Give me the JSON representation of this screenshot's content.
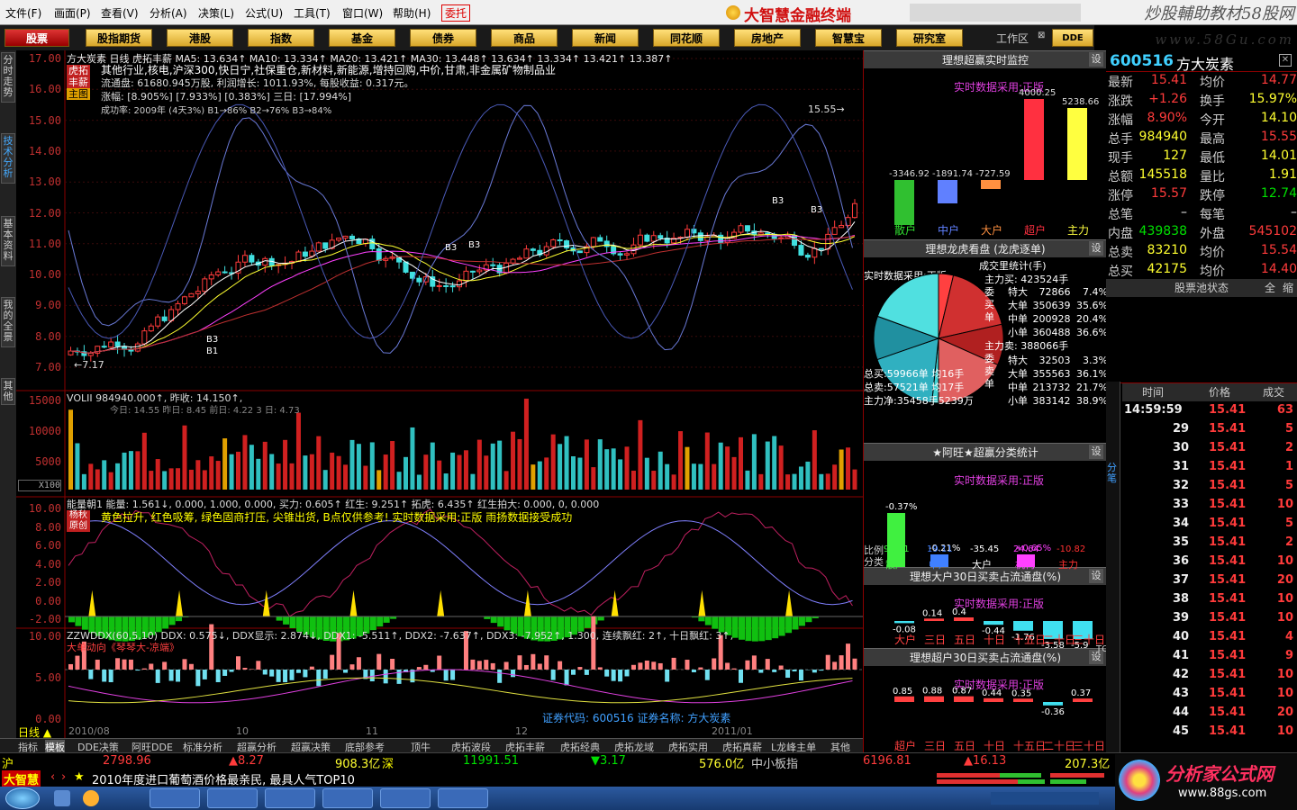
{
  "menu": {
    "items": [
      "文件(F)",
      "画面(P)",
      "查看(V)",
      "分析(A)",
      "决策(L)",
      "公式(U)",
      "工具(T)",
      "窗口(W)",
      "帮助(H)"
    ],
    "entrust": "委托",
    "brand": "大智慧金融终端",
    "watermark_top": "炒股輔助教材58股网",
    "watermark_url": "www.58Gu.com"
  },
  "nav": {
    "items": [
      "股票",
      "股指期货",
      "港股",
      "指数",
      "基金",
      "债券",
      "商品",
      "新闻",
      "同花顺",
      "房地产",
      "智慧宝",
      "研究室"
    ],
    "workspace": "工作区",
    "dde": "DDE"
  },
  "sidebar": {
    "tabs": [
      "分时走势",
      "技术分析",
      "基本资料",
      "我的全景",
      "其他"
    ]
  },
  "main": {
    "header": "方大炭素 日线 虎拓丰薪 MA5: 13.634↑ MA10: 13.334↑ MA20: 13.421↑ MA30: 13.448↑ 13.634↑ 13.334↑ 13.421↑ 13.387↑",
    "tags": [
      "虎拓",
      "丰薪",
      "主图"
    ],
    "info1": "其他行业,核电,沪深300,快日宁,社保重仓,新材料,新能源,增持回购,中价,甘肃,非金属矿物制品业",
    "info2": "流通盘: 61680.945万股, 利润增长: 1011.93%, 每股收益: 0.317元。",
    "info3": "涨幅: [8.905%] [7.933%] [0.383%] 三日: [17.994%]",
    "info4": "成功率: 2009年 (4天3%) B1→86% B2→76% B3→84%",
    "price_labels": [
      "17.00",
      "16.00",
      "15.00",
      "14.00",
      "13.00",
      "12.00",
      "11.00",
      "10.00",
      "9.00",
      "8.00",
      "7.00"
    ],
    "low_label": "7.17",
    "high_label": "15.55",
    "b_labels": [
      "B1",
      "B3",
      "B3",
      "B3",
      "B3",
      "B3"
    ],
    "vol_header": "VOLII 984940.000↑, 昨收: 14.150↑,",
    "vol_sub": "今日: 14.55  昨日: 8.45  前日: 4.22  3 日: 4.73",
    "vol_labels": [
      "15000",
      "10000",
      "5000",
      "X100"
    ],
    "energy_header": "能量朝1  能量: 1.561↓, 0.000, 1.000, 0.000, 买力: 0.605↑ 红生: 9.251↑ 拓虎: 6.435↑ 红生拍大: 0.000, 0, 0.000",
    "energy_sub": "黄色拉升, 红色吸筹, 绿色固商打压, 尖锥出货, B点仅供参考!  实时数据采用:正版  雨扬数据接受成功",
    "energy_tags": [
      "杨秋",
      "原创"
    ],
    "energy_labels": [
      "10.00",
      "8.00",
      "6.00",
      "4.00",
      "2.00",
      "0.00",
      "-2.00"
    ],
    "ddx_header": "ZZWDDX(60,5,10) DDX: 0.575↓, DDX显示: 2.874↓, DDX1: -5.511↑, DDX2: -7.637↑, DDX3: -7.952↑, 1.300, 连续飘红: 2↑, 十日飘红: 3↑,",
    "ddx_sub": "大单动向《琴琴大-凉端》",
    "ddx_labels": [
      "10.00",
      "5.00",
      "0.00"
    ],
    "stock_code": "证券代码: 600516  证券名称: 方大炭素",
    "date_labels": [
      "2010/08",
      "10",
      "11",
      "12",
      "2011/01"
    ],
    "period": "日线"
  },
  "right": {
    "h1": "理想超赢实时监控",
    "set": "设",
    "realtime": "实时数据采用:正版",
    "bars1": [
      {
        "label": "散户",
        "val": "-3346.92"
      },
      {
        "label": "中户",
        "val": "-1891.74"
      },
      {
        "label": "大户",
        "val": "-727.59"
      },
      {
        "label": "超户",
        "val": "4000.25"
      },
      {
        "label": "主力",
        "val": "5238.66"
      }
    ],
    "h2": "理想龙虎看盘 (龙虎逐单)",
    "vol_stat_title": "成交里统计(手)",
    "buy_main": "主力买: 423524手",
    "buy_rows": [
      [
        "特大",
        "72866",
        "7.4%"
      ],
      [
        "大单",
        "350639",
        "35.6%"
      ],
      [
        "中单",
        "200928",
        "20.4%"
      ],
      [
        "小单",
        "360488",
        "36.6%"
      ]
    ],
    "sell_main": "主力卖: 388066手",
    "sell_rows": [
      [
        "特大",
        "32503",
        "3.3%"
      ],
      [
        "大单",
        "355563",
        "36.1%"
      ],
      [
        "中单",
        "213732",
        "21.7%"
      ],
      [
        "小单",
        "383142",
        "38.9%"
      ]
    ],
    "side_buy": "委买单",
    "side_sell": "委卖单",
    "total_buy": "总买:59966单 均16手",
    "total_sell": "总卖:57521单 均17手",
    "main_net": "主力净:35458手5239万",
    "h3": "★阿旺★超赢分类统计",
    "bars3": [
      {
        "label": "散户",
        "pct": "-0.37%",
        "val": "91.71"
      },
      {
        "label": "中户",
        "pct": "-0.21%",
        "val": "19.11"
      },
      {
        "label": "大户",
        "pct": "",
        "val": "-35.45"
      },
      {
        "label": "机构",
        "pct": "+0.65%",
        "val": "24.64"
      },
      {
        "label": "主力",
        "pct": "",
        "val": "-10.82"
      }
    ],
    "ratio_label": "比例分类",
    "h4": "理想大户30日买卖占流通盘(%)",
    "bars4": {
      "labels": [
        "大户",
        "三日",
        "五日",
        "十日",
        "十五日",
        "二十日",
        "三十日"
      ],
      "vals": [
        "-0.08",
        "0.14",
        "0.4",
        "-0.44",
        "-1.76",
        "-3.58",
        "-5.9"
      ]
    },
    "h5": "理想超户30日买卖占流通盘(%)",
    "bars5": {
      "labels": [
        "超户",
        "三日",
        "五日",
        "十日",
        "十五日",
        "二十日",
        "三十日"
      ],
      "vals": [
        "0.85",
        "0.88",
        "0.87",
        "0.44",
        "0.35",
        "-0.36",
        "0.37"
      ]
    },
    "top_label": "TOP"
  },
  "quote": {
    "code": "600516",
    "name": "方大炭素",
    "rows": [
      {
        "l": "最新",
        "v1": "15.41",
        "c1": "red",
        "l2": "均价",
        "v2": "14.77",
        "c2": "red"
      },
      {
        "l": "涨跌",
        "v1": "+1.26",
        "c1": "red",
        "l2": "换手",
        "v2": "15.97%",
        "c2": "yellow"
      },
      {
        "l": "涨幅",
        "v1": "8.90%",
        "c1": "red",
        "l2": "今开",
        "v2": "14.10",
        "c2": "yellow"
      },
      {
        "l": "总手",
        "v1": "984940",
        "c1": "yellow",
        "l2": "最高",
        "v2": "15.55",
        "c2": "red"
      },
      {
        "l": "现手",
        "v1": "127",
        "c1": "yellow",
        "l2": "最低",
        "v2": "14.01",
        "c2": "yellow"
      },
      {
        "l": "总额",
        "v1": "145518",
        "c1": "yellow",
        "l2": "量比",
        "v2": "1.91",
        "c2": "yellow"
      },
      {
        "l": "涨停",
        "v1": "15.57",
        "c1": "red",
        "l2": "跌停",
        "v2": "12.74",
        "c2": "green"
      },
      {
        "l": "总笔",
        "v1": "–",
        "c1": "white",
        "l2": "每笔",
        "v2": "–",
        "c2": "white"
      },
      {
        "l": "内盘",
        "v1": "439838",
        "c1": "green",
        "l2": "外盘",
        "v2": "545102",
        "c2": "red"
      },
      {
        "l": "总卖",
        "v1": "83210",
        "c1": "yellow",
        "l2": "均价",
        "v2": "15.54",
        "c2": "red"
      },
      {
        "l": "总买",
        "v1": "42175",
        "c1": "yellow",
        "l2": "均价",
        "v2": "14.40",
        "c2": "red"
      }
    ],
    "pool": "股票池状态",
    "full": "全",
    "shrink": "缩",
    "thead": [
      "时间",
      "价格",
      "成交"
    ],
    "ticks": [
      [
        "14:59:59",
        "15.41",
        "63"
      ],
      [
        "29",
        "15.41",
        "5"
      ],
      [
        "30",
        "15.41",
        "2"
      ],
      [
        "31",
        "15.41",
        "1"
      ],
      [
        "32",
        "15.41",
        "5"
      ],
      [
        "33",
        "15.41",
        "10"
      ],
      [
        "34",
        "15.41",
        "5"
      ],
      [
        "35",
        "15.41",
        "2"
      ],
      [
        "36",
        "15.41",
        "10"
      ],
      [
        "37",
        "15.41",
        "20"
      ],
      [
        "38",
        "15.41",
        "10"
      ],
      [
        "39",
        "15.41",
        "10"
      ],
      [
        "40",
        "15.41",
        "4"
      ],
      [
        "41",
        "15.41",
        "9"
      ],
      [
        "42",
        "15.41",
        "10"
      ],
      [
        "43",
        "15.41",
        "10"
      ],
      [
        "44",
        "15.41",
        "20"
      ],
      [
        "45",
        "15.41",
        "10"
      ]
    ],
    "side_tab": "分笔"
  },
  "bottom_tabs": [
    "指标",
    "模板",
    "DDE决策",
    "阿旺DDE",
    "标准分析",
    "超赢分析",
    "超赢决策",
    "底部参考",
    "顶牛",
    "虎拓波段",
    "虎拓丰薪",
    "虎拓经典",
    "虎拓龙域",
    "虎拓实用",
    "虎拓真薪",
    "L龙峰主单",
    "其他"
  ],
  "status": {
    "sh": "沪",
    "sh_idx": "2798.96",
    "sh_chg": "▲8.27",
    "sh_amt": "908.3亿",
    "sz": "深",
    "sz_idx": "11991.51",
    "sz_chg": "▼3.17",
    "sz_amt": "576.0亿",
    "board": "中小板指",
    "board_idx": "6196.81",
    "board_chg": "▲16.13",
    "board_amt": "207.3亿"
  },
  "ticker": {
    "logo": "大智慧",
    "news": "2010年度进口葡萄酒价格最亲民, 最具人气TOP10"
  },
  "watermark_bottom": "分析家公式网",
  "watermark_bottom_url": "www.88gs.com"
}
